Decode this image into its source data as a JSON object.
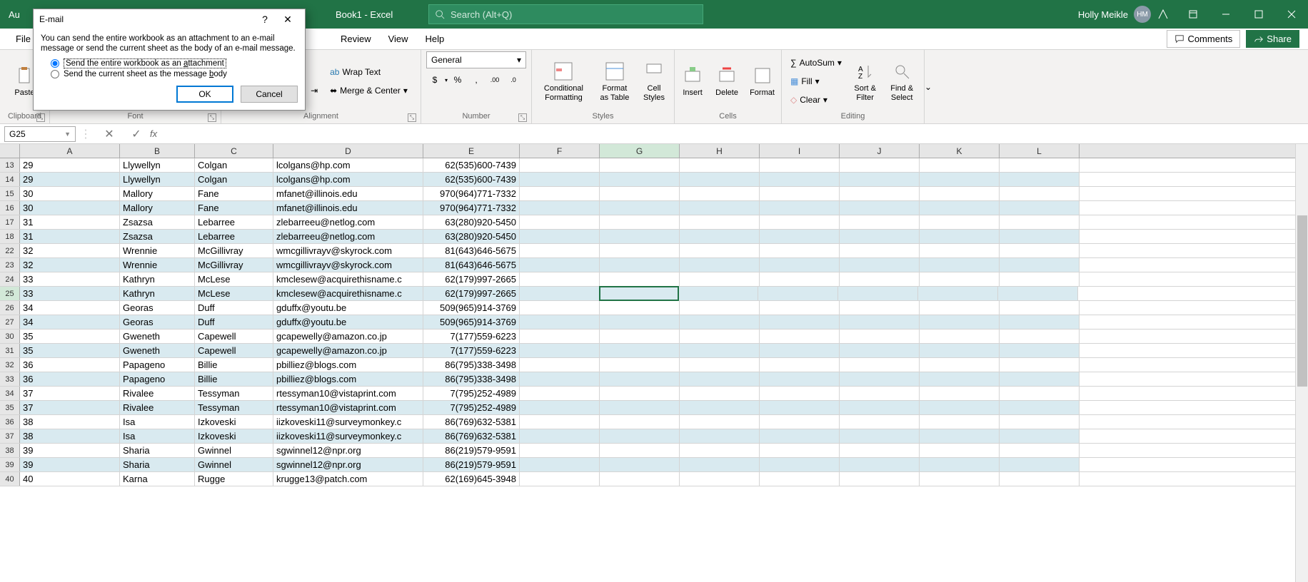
{
  "titlebar": {
    "book": "Book1 - Excel",
    "search_placeholder": "Search (Alt+Q)",
    "user_name": "Holly Meikle",
    "user_initials": "HM"
  },
  "tabs": {
    "file": "File",
    "review": "Review",
    "view": "View",
    "help": "Help",
    "comments": "Comments",
    "share": "Share"
  },
  "ribbon": {
    "clipboard": {
      "paste": "Paste",
      "label": "Clipboard"
    },
    "font_label": "Font",
    "alignment": {
      "wrap": "Wrap Text",
      "merge": "Merge & Center",
      "label": "Alignment"
    },
    "number": {
      "fmt": "General",
      "label": "Number"
    },
    "styles": {
      "cond": "Conditional Formatting",
      "fat": "Format as Table",
      "cell": "Cell Styles",
      "label": "Styles"
    },
    "cells": {
      "ins": "Insert",
      "del": "Delete",
      "fmt": "Format",
      "label": "Cells"
    },
    "editing": {
      "sum": "AutoSum",
      "fill": "Fill",
      "clear": "Clear",
      "sort": "Sort & Filter",
      "find": "Find & Select",
      "label": "Editing"
    }
  },
  "fbar": {
    "name": "G25"
  },
  "columns": [
    "A",
    "B",
    "C",
    "D",
    "E",
    "F",
    "G",
    "H",
    "I",
    "J",
    "K",
    "L"
  ],
  "active_col": "G",
  "rows": [
    {
      "n": 13,
      "a": "29",
      "b": "Llywellyn",
      "c": "Colgan",
      "d": "lcolgans@hp.com",
      "e": "62(535)600-7439"
    },
    {
      "n": 14,
      "a": "29",
      "b": "Llywellyn",
      "c": "Colgan",
      "d": "lcolgans@hp.com",
      "e": "62(535)600-7439",
      "sel": true
    },
    {
      "n": 15,
      "a": "30",
      "b": "Mallory",
      "c": "Fane",
      "d": "mfanet@illinois.edu",
      "e": "970(964)771-7332"
    },
    {
      "n": 16,
      "a": "30",
      "b": "Mallory",
      "c": "Fane",
      "d": "mfanet@illinois.edu",
      "e": "970(964)771-7332",
      "sel": true
    },
    {
      "n": 17,
      "a": "31",
      "b": "Zsazsa",
      "c": "Lebarree",
      "d": "zlebarreeu@netlog.com",
      "e": "63(280)920-5450"
    },
    {
      "n": 18,
      "a": "31",
      "b": "Zsazsa",
      "c": "Lebarree",
      "d": "zlebarreeu@netlog.com",
      "e": "63(280)920-5450",
      "sel": true
    },
    {
      "n": 22,
      "a": "32",
      "b": "Wrennie",
      "c": "McGillivray",
      "d": "wmcgillivrayv@skyrock.com",
      "e": "81(643)646-5675"
    },
    {
      "n": 23,
      "a": "32",
      "b": "Wrennie",
      "c": "McGillivray",
      "d": "wmcgillivrayv@skyrock.com",
      "e": "81(643)646-5675",
      "sel": true
    },
    {
      "n": 24,
      "a": "33",
      "b": "Kathryn",
      "c": "McLese",
      "d": "kmclesew@acquirethisname.c",
      "e": "62(179)997-2665"
    },
    {
      "n": 25,
      "a": "33",
      "b": "Kathryn",
      "c": "McLese",
      "d": "kmclesew@acquirethisname.c",
      "e": "62(179)997-2665",
      "sel": true,
      "active": true
    },
    {
      "n": 26,
      "a": "34",
      "b": "Georas",
      "c": "Duff",
      "d": "gduffx@youtu.be",
      "e": "509(965)914-3769"
    },
    {
      "n": 27,
      "a": "34",
      "b": "Georas",
      "c": "Duff",
      "d": "gduffx@youtu.be",
      "e": "509(965)914-3769",
      "sel": true
    },
    {
      "n": 30,
      "a": "35",
      "b": "Gweneth",
      "c": "Capewell",
      "d": "gcapewelly@amazon.co.jp",
      "e": "7(177)559-6223"
    },
    {
      "n": 31,
      "a": "35",
      "b": "Gweneth",
      "c": "Capewell",
      "d": "gcapewelly@amazon.co.jp",
      "e": "7(177)559-6223",
      "sel": true
    },
    {
      "n": 32,
      "a": "36",
      "b": "Papageno",
      "c": "Billie",
      "d": "pbilliez@blogs.com",
      "e": "86(795)338-3498"
    },
    {
      "n": 33,
      "a": "36",
      "b": "Papageno",
      "c": "Billie",
      "d": "pbilliez@blogs.com",
      "e": "86(795)338-3498",
      "sel": true
    },
    {
      "n": 34,
      "a": "37",
      "b": "Rivalee",
      "c": "Tessyman",
      "d": "rtessyman10@vistaprint.com",
      "e": "7(795)252-4989"
    },
    {
      "n": 35,
      "a": "37",
      "b": "Rivalee",
      "c": "Tessyman",
      "d": "rtessyman10@vistaprint.com",
      "e": "7(795)252-4989",
      "sel": true
    },
    {
      "n": 36,
      "a": "38",
      "b": "Isa",
      "c": "Izkoveski",
      "d": "iizkoveski11@surveymonkey.c",
      "e": "86(769)632-5381"
    },
    {
      "n": 37,
      "a": "38",
      "b": "Isa",
      "c": "Izkoveski",
      "d": "iizkoveski11@surveymonkey.c",
      "e": "86(769)632-5381",
      "sel": true
    },
    {
      "n": 38,
      "a": "39",
      "b": "Sharia",
      "c": "Gwinnel",
      "d": "sgwinnel12@npr.org",
      "e": "86(219)579-9591"
    },
    {
      "n": 39,
      "a": "39",
      "b": "Sharia",
      "c": "Gwinnel",
      "d": "sgwinnel12@npr.org",
      "e": "86(219)579-9591",
      "sel": true
    },
    {
      "n": 40,
      "a": "40",
      "b": "Karna",
      "c": "Rugge",
      "d": "krugge13@patch.com",
      "e": "62(169)645-3948"
    }
  ],
  "dialog": {
    "title": "E-mail",
    "msg": "You can send the entire workbook as an attachment to an e-mail message or send the current sheet as the body of an e-mail message.",
    "opt1_pre": "Send the entire workbook as an ",
    "opt1_u": "a",
    "opt1_post": "ttachment",
    "opt2_pre": "Send the current sheet as the message ",
    "opt2_u": "b",
    "opt2_post": "ody",
    "ok": "OK",
    "cancel": "Cancel"
  }
}
